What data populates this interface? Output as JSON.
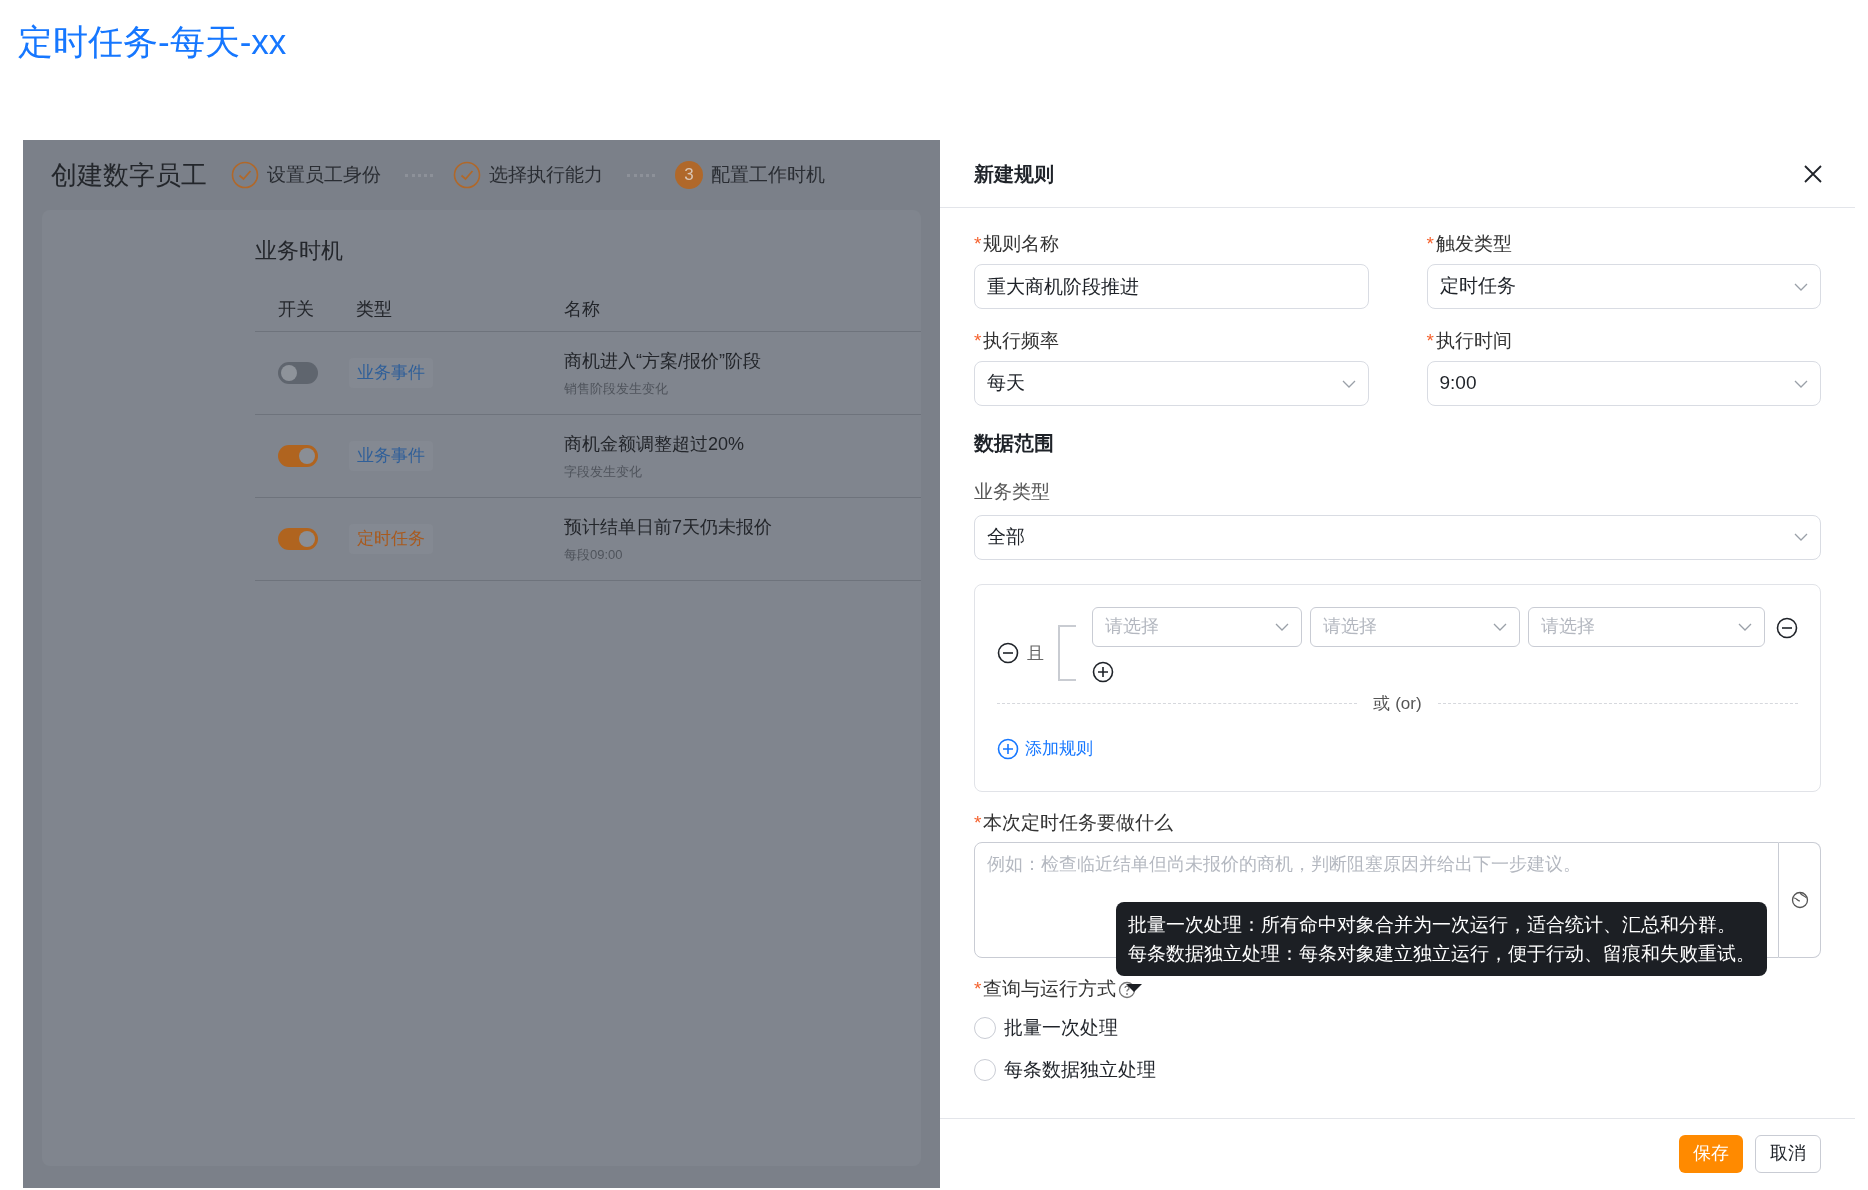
{
  "page_title": "定时任务-每天-xx",
  "wizard": {
    "title": "创建数字员工",
    "steps": [
      {
        "label": "设置员工身份",
        "kind": "done"
      },
      {
        "label": "选择执行能力",
        "kind": "done"
      },
      {
        "number": "3",
        "label": "配置工作时机",
        "kind": "current"
      }
    ]
  },
  "section": {
    "title": "业务时机",
    "columns": [
      "开关",
      "类型",
      "名称"
    ],
    "rows": [
      {
        "on": false,
        "type": {
          "label": "业务事件",
          "kind": "event"
        },
        "name": "商机进入“方案/报价”阶段",
        "subtitle": "销售阶段发生变化"
      },
      {
        "on": true,
        "type": {
          "label": "业务事件",
          "kind": "event"
        },
        "name": "商机金额调整超过20%",
        "subtitle": "字段发生变化"
      },
      {
        "on": true,
        "type": {
          "label": "定时任务",
          "kind": "schedule"
        },
        "name": "预计结单日前7天仍未报价",
        "subtitle": "每段09:00"
      }
    ]
  },
  "drawer": {
    "title": "新建规则",
    "fields": [
      {
        "label": "规则名称",
        "required_mark": "*",
        "kind": "input",
        "value": "重大商机阶段推进"
      },
      {
        "label": "触发类型",
        "required_mark": "*",
        "kind": "select",
        "value": "定时任务"
      },
      {
        "label": "执行频率",
        "required_mark": "*",
        "kind": "select",
        "value": "每天"
      },
      {
        "label": "执行时间",
        "required_mark": "*",
        "kind": "select",
        "value": "9:00"
      }
    ],
    "data_range": {
      "title": "数据范围",
      "business_type": {
        "label": "业务类型",
        "value": "全部"
      },
      "condition": {
        "connector": "且",
        "selects": [
          {
            "placeholder": "请选择"
          },
          {
            "placeholder": "请选择"
          },
          {
            "placeholder": "请选择"
          }
        ],
        "divider": "或 (or)",
        "add_link": "添加规则"
      }
    },
    "task": {
      "label": "本次定时任务要做什么",
      "required_mark": "*",
      "placeholder": "例如：检查临近结单但尚未报价的商机，判断阻塞原因并给出下一步建议。"
    },
    "tooltip": {
      "lines": [
        "批量一次处理：所有命中对象合并为一次运行，适合统计、汇总和分群。",
        "每条数据独立处理：每条对象建立独立运行，便于行动、留痕和失败重试。"
      ]
    },
    "run_mode": {
      "label": "查询与运行方式",
      "required_mark": "*",
      "options": [
        {
          "label": "批量一次处理",
          "selected": false
        },
        {
          "label": "每条数据独立处理",
          "selected": false
        }
      ]
    },
    "buttons": [
      {
        "label": "保存",
        "kind": "primary"
      },
      {
        "label": "取消",
        "kind": "default"
      }
    ]
  }
}
